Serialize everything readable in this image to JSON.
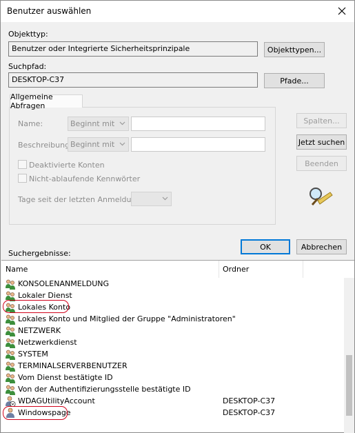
{
  "window": {
    "title": "Benutzer auswählen",
    "close_icon": "close-icon"
  },
  "object_type": {
    "label": "Objekttyp:",
    "value": "Benutzer oder Integrierte Sicherheitsprinzipale",
    "button": "Objekttypen..."
  },
  "search_path": {
    "label": "Suchpfad:",
    "value": "DESKTOP-C37",
    "button": "Pfade..."
  },
  "tab": {
    "label": "Allgemeine Abfragen"
  },
  "query": {
    "name_label": "Name:",
    "name_mode": "Beginnt mit",
    "name_value": "",
    "desc_label": "Beschreibung:",
    "desc_mode": "Beginnt mit",
    "desc_value": "",
    "disabled_accounts": "Deaktivierte Konten",
    "non_expiring": "Nicht-ablaufende Kennwörter",
    "days_label": "Tage seit der letzten Anmeldung:",
    "days_value": ""
  },
  "side_buttons": {
    "columns": "Spalten...",
    "search_now": "Jetzt suchen",
    "stop": "Beenden"
  },
  "dialog_buttons": {
    "ok": "OK",
    "cancel": "Abbrechen"
  },
  "results": {
    "label": "Suchergebnisse:",
    "columns": [
      "Name",
      "Ordner"
    ],
    "rows": [
      {
        "name": "KONSOLENANMELDUNG",
        "folder": ""
      },
      {
        "name": "Lokaler Dienst",
        "folder": ""
      },
      {
        "name": "Lokales Konto",
        "folder": ""
      },
      {
        "name": "Lokales Konto und Mitglied der Gruppe \"Administratoren\"",
        "folder": ""
      },
      {
        "name": "NETZWERK",
        "folder": ""
      },
      {
        "name": "Netzwerkdienst",
        "folder": ""
      },
      {
        "name": "SYSTEM",
        "folder": ""
      },
      {
        "name": "TERMINALSERVERBENUTZER",
        "folder": ""
      },
      {
        "name": "Vom Dienst bestätigte ID",
        "folder": ""
      },
      {
        "name": "Von der Authentifizierungsstelle bestätigte ID",
        "folder": ""
      },
      {
        "name": "WDAGUtilityAccount",
        "folder": "DESKTOP-C37"
      },
      {
        "name": "Windowspage",
        "folder": "DESKTOP-C37"
      }
    ]
  },
  "colors": {
    "default_button_border": "#0078d7",
    "annotation_circle": "#d0021b"
  }
}
